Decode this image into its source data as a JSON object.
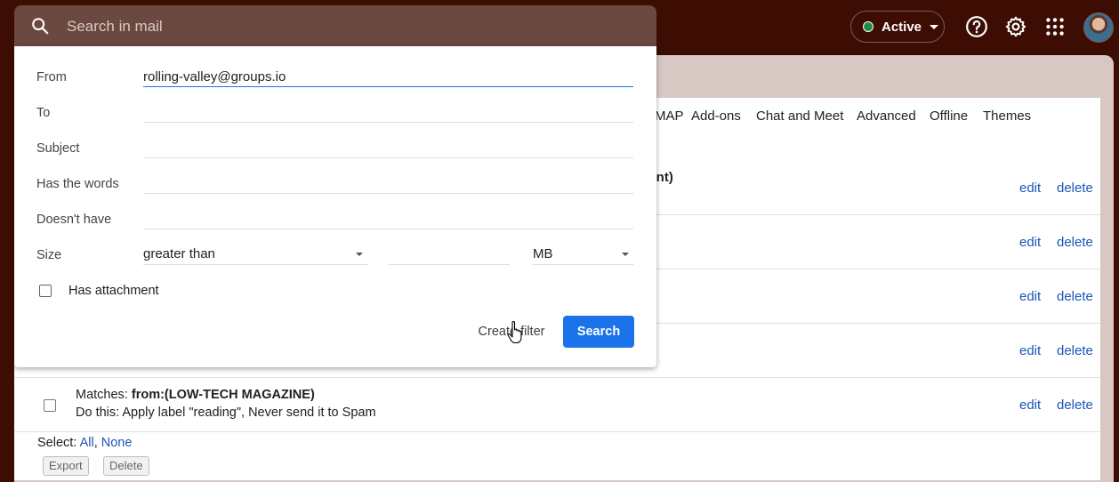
{
  "search": {
    "placeholder": "Search in mail"
  },
  "status": {
    "label": "Active"
  },
  "tabs": [
    "MAP",
    "Add-ons",
    "Chat and Meet",
    "Advanced",
    "Offline",
    "Themes"
  ],
  "filters": [
    {
      "text": "ment)",
      "edit": "edit",
      "delete": "delete"
    },
    {
      "text": "",
      "edit": "edit",
      "delete": "delete"
    },
    {
      "text": "",
      "edit": "edit",
      "delete": "delete"
    },
    {
      "text": "",
      "edit": "edit",
      "delete": "delete"
    },
    {
      "matches_label": "Matches:",
      "matches_value": "from:(LOW-TECH MAGAZINE)",
      "action": "Do this: Apply label \"reading\", Never send it to Spam",
      "edit": "edit",
      "delete": "delete"
    }
  ],
  "select": {
    "label": "Select:",
    "all": "All",
    "none": "None"
  },
  "bottom_buttons": {
    "export": "Export",
    "delete": "Delete"
  },
  "search_options": {
    "from_label": "From",
    "from_value": "rolling-valley@groups.io",
    "to_label": "To",
    "to_value": "",
    "subject_label": "Subject",
    "subject_value": "",
    "has_words_label": "Has the words",
    "has_words_value": "",
    "doesnt_have_label": "Doesn't have",
    "doesnt_have_value": "",
    "size_label": "Size",
    "size_operator": "greater than",
    "size_value": "",
    "size_unit": "MB",
    "attachment_label": "Has attachment",
    "create_filter_label": "Create filter",
    "search_label": "Search"
  },
  "colors": {
    "background": "#3d0c02",
    "accent": "#1a73e8",
    "link": "#1a56b8",
    "status_dot": "#1e8e3e"
  },
  "icons": [
    "search-icon",
    "help-icon",
    "gear-icon",
    "apps-grid-icon",
    "avatar",
    "pointer-cursor-icon"
  ]
}
